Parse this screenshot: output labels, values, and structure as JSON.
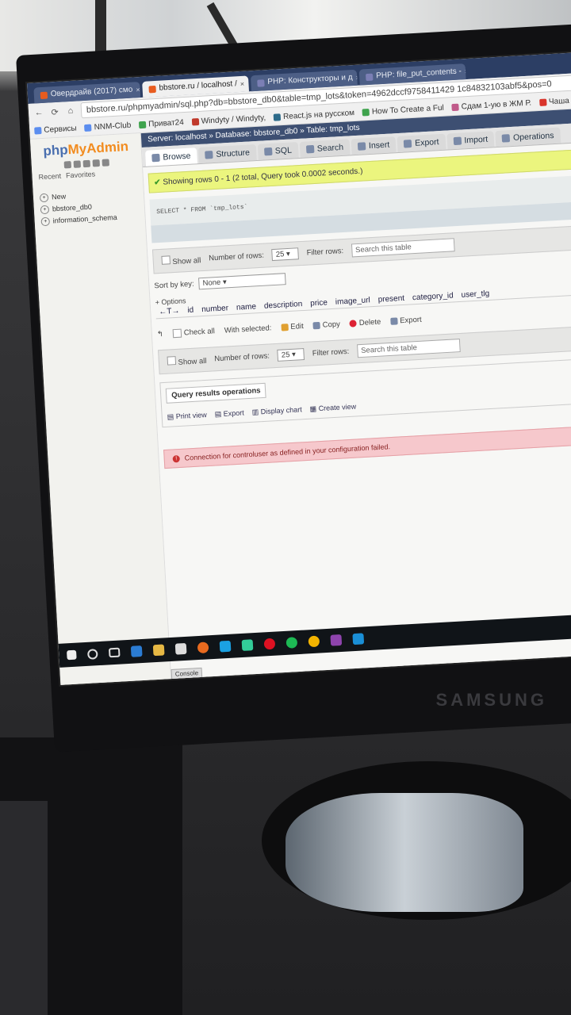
{
  "browser": {
    "tabs": [
      {
        "label": "Овердрайв (2017) смо",
        "active": false
      },
      {
        "label": "bbstore.ru / localhost /",
        "active": true
      },
      {
        "label": "PHP: Конструкторы и д",
        "active": false
      },
      {
        "label": "PHP: file_put_contents -",
        "active": false
      }
    ],
    "url": "bbstore.ru/phpmyadmin/sql.php?db=bbstore_db0&table=tmp_lots&token=4962dccf9758411429 1c84832103abf5&pos=0",
    "bookmarks": [
      "Сервисы",
      "NNM-Club",
      "Приват24",
      "Windyty / Windyty,",
      "React.js на русском",
      "How To Create a Ful",
      "Сдам 1-ую в ЖМ Р.",
      "Чаша для мул"
    ]
  },
  "sidebar": {
    "logo_php": "php",
    "logo_admin": "MyAdmin",
    "recent": "Recent",
    "favorites": "Favorites",
    "tree": [
      "New",
      "bbstore_db0",
      "information_schema"
    ]
  },
  "breadcrumb": "Server: localhost » Database: bbstore_db0 » Table: tmp_lots",
  "menu": [
    "Browse",
    "Structure",
    "SQL",
    "Search",
    "Insert",
    "Export",
    "Import",
    "Operations"
  ],
  "success_message": "Showing rows 0 - 1 (2 total, Query took 0.0002 seconds.)",
  "sql_query": "SELECT * FROM `tmp_lots`",
  "nav_top": {
    "show_all": "Show all",
    "number_of_rows_label": "Number of rows:",
    "number_of_rows": "25",
    "filter_label": "Filter rows:",
    "filter_placeholder": "Search this table"
  },
  "sort": {
    "label": "Sort by key:",
    "value": "None"
  },
  "options_label": "+ Options",
  "columns": [
    "id",
    "number",
    "name",
    "description",
    "price",
    "image_url",
    "present",
    "category_id",
    "user_tlg"
  ],
  "actions": {
    "check_all": "Check all",
    "with_selected": "With selected:",
    "edit": "Edit",
    "copy": "Copy",
    "delete": "Delete",
    "export": "Export"
  },
  "nav_bottom": {
    "show_all": "Show all",
    "number_of_rows_label": "Number of rows:",
    "number_of_rows": "25",
    "filter_label": "Filter rows:",
    "filter_placeholder": "Search this table"
  },
  "query_results": {
    "title": "Query results operations",
    "links": [
      "Print view",
      "Export",
      "Display chart",
      "Create view"
    ]
  },
  "error_message": "Connection for controluser as defined in your configuration failed.",
  "console_label": "Console",
  "monitor_brand": "SAMSUNG"
}
